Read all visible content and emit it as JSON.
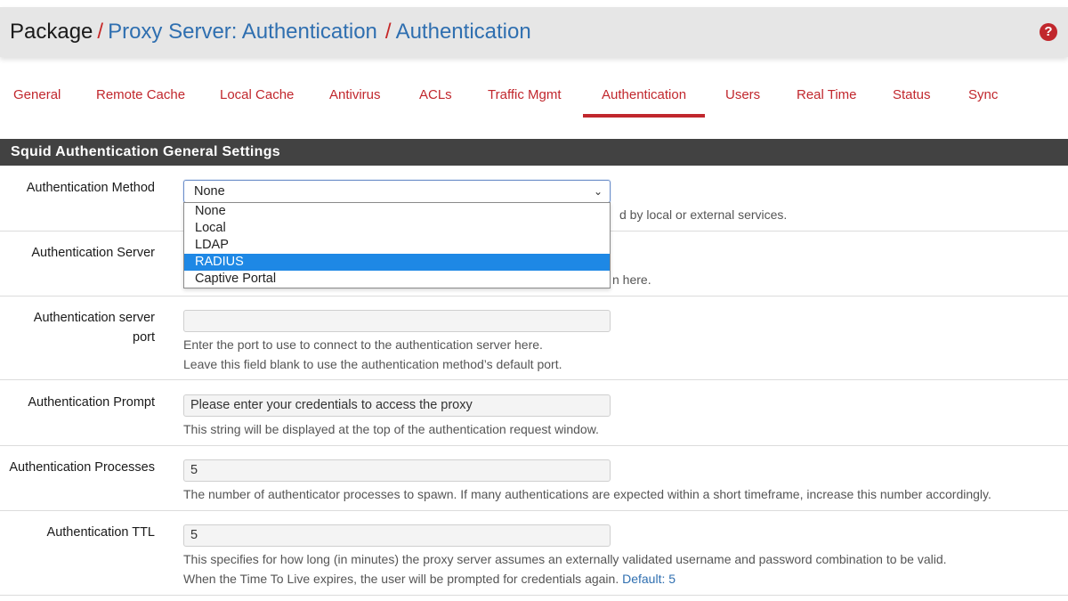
{
  "breadcrumb": {
    "root": "Package",
    "separator": "/",
    "items": [
      "Proxy Server: Authentication",
      "Authentication"
    ]
  },
  "help_icon_glyph": "?",
  "tabs": [
    {
      "label": "General"
    },
    {
      "label": "Remote Cache"
    },
    {
      "label": "Local Cache"
    },
    {
      "label": "Antivirus"
    },
    {
      "label": "ACLs"
    },
    {
      "label": "Traffic Mgmt"
    },
    {
      "label": "Authentication",
      "active": true
    },
    {
      "label": "Users"
    },
    {
      "label": "Real Time"
    },
    {
      "label": "Status"
    },
    {
      "label": "Sync"
    }
  ],
  "panel_title": "Squid Authentication General Settings",
  "fields": {
    "auth_method": {
      "label": "Authentication Method",
      "value": "None",
      "help_fragment": "d by local or external services.",
      "options": [
        "None",
        "Local",
        "LDAP",
        "RADIUS",
        "Captive Portal"
      ],
      "highlighted_option": "RADIUS"
    },
    "auth_server": {
      "label": "Authentication Server",
      "help_fragment": "n here."
    },
    "auth_server_port": {
      "label_line1": "Authentication server",
      "label_line2": "port",
      "value": "",
      "help_line1": "Enter the port to use to connect to the authentication server here.",
      "help_line2": "Leave this field blank to use the authentication method’s default port."
    },
    "auth_prompt": {
      "label": "Authentication Prompt",
      "value": "Please enter your credentials to access the proxy",
      "help": "This string will be displayed at the top of the authentication request window."
    },
    "auth_processes": {
      "label": "Authentication Processes",
      "value": "5",
      "help": "The number of authenticator processes to spawn. If many authentications are expected within a short timeframe, increase this number accordingly."
    },
    "auth_ttl": {
      "label": "Authentication TTL",
      "value": "5",
      "help_line1": "This specifies for how long (in minutes) the proxy server assumes an externally validated username and password combination to be valid.",
      "help_line2": "When the Time To Live expires, the user will be prompted for credentials again.",
      "help_default": "Default: 5"
    }
  },
  "colors": {
    "accent_red": "#c1272d",
    "link_blue": "#2f6fb0",
    "panel_heading_bg": "#424242",
    "selected_option_bg": "#1e88e5"
  }
}
